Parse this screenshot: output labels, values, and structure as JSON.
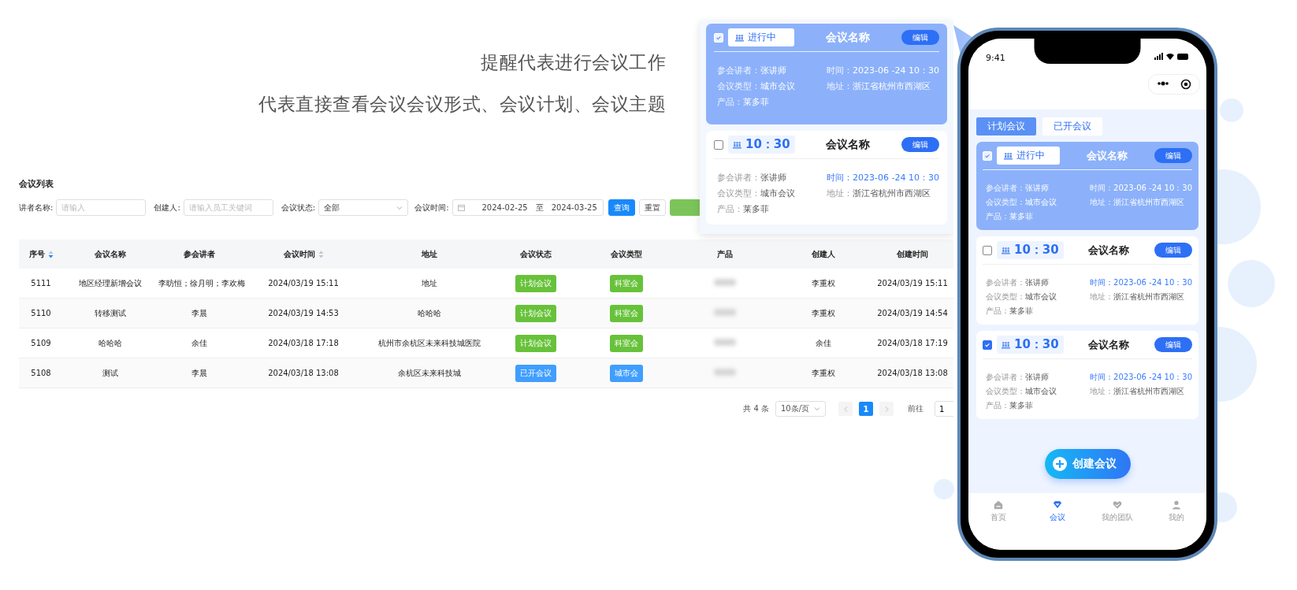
{
  "headline": [
    "提醒代表进行会议工作",
    "代表直接查看会议会议形式、会议计划、会议主题"
  ],
  "list": {
    "title": "会议列表",
    "filters": [
      {
        "kind": "input",
        "label": "讲者名称:",
        "placeholder": "请输入"
      },
      {
        "kind": "input",
        "label": "创建人:",
        "placeholder": "请输入员工关键词"
      },
      {
        "kind": "select",
        "label": "会议状态:",
        "value": "全部"
      },
      {
        "kind": "daterange",
        "label": "会议时间:",
        "start": "2024-02-25",
        "separator": "至",
        "end": "2024-03-25"
      }
    ],
    "buttons": [
      {
        "kind": "primary",
        "label": "查询"
      },
      {
        "kind": "default",
        "label": "重置"
      },
      {
        "kind": "success"
      }
    ],
    "columns": [
      {
        "label": "序号",
        "sortable": true,
        "sorted": true
      },
      {
        "label": "会议名称",
        "sortable": false
      },
      {
        "label": "参会讲者",
        "sortable": false
      },
      {
        "label": "会议时间",
        "sortable": true,
        "sorted": false
      },
      {
        "label": "地址",
        "sortable": false
      },
      {
        "label": "会议状态",
        "sortable": false
      },
      {
        "label": "会议类型",
        "sortable": false
      },
      {
        "label": "产品",
        "sortable": false
      },
      {
        "label": "创建人",
        "sortable": false
      },
      {
        "label": "创建时间",
        "sortable": false
      }
    ],
    "rows": [
      {
        "id": "5111",
        "name": "地区经理新增会议",
        "speakers": "李昉恒；徐月明；李欢梅",
        "time": "2024/03/19 15:11",
        "address": "地址",
        "status": {
          "label": "计划会议",
          "color": "#67c23a"
        },
        "type": {
          "label": "科室会",
          "color": "#67c23a"
        },
        "creator": "李重权",
        "created": "2024/03/19 15:11"
      },
      {
        "id": "5110",
        "name": "转移测试",
        "speakers": "李晨",
        "time": "2024/03/19 14:53",
        "address": "哈哈哈",
        "status": {
          "label": "计划会议",
          "color": "#67c23a"
        },
        "type": {
          "label": "科室会",
          "color": "#67c23a"
        },
        "creator": "李重权",
        "created": "2024/03/19 14:54"
      },
      {
        "id": "5109",
        "name": "哈哈哈",
        "speakers": "余佳",
        "time": "2024/03/18 17:18",
        "address": "杭州市余杭区未来科技城医院",
        "status": {
          "label": "计划会议",
          "color": "#67c23a"
        },
        "type": {
          "label": "科室会",
          "color": "#67c23a"
        },
        "creator": "余佳",
        "created": "2024/03/18 17:19"
      },
      {
        "id": "5108",
        "name": "测试",
        "speakers": "李晨",
        "time": "2024/03/18 13:08",
        "address": "余杭区未来科技城",
        "status": {
          "label": "已开会议",
          "color": "#409eff"
        },
        "type": {
          "label": "城市会",
          "color": "#409eff"
        },
        "creator": "李重权",
        "created": "2024/03/18 13:08"
      }
    ],
    "pagination": {
      "total": "共 4 条",
      "page_size": "10条/页",
      "pages": [
        {
          "label": "1",
          "selected": true
        }
      ],
      "goto_label": "前往",
      "goto_value": "1"
    }
  },
  "popup": {
    "cards": [
      {
        "selected": true,
        "checked": true,
        "badge": {
          "kind": "status",
          "text": "进行中"
        },
        "title": "会议名称",
        "edit": "编辑",
        "fields": [
          {
            "label": "参会讲者：",
            "value": "张讲师"
          },
          {
            "label": "时间：",
            "value": "2023-06 -24 10：30"
          },
          {
            "label": "会议类型：",
            "value": "城市会议"
          },
          {
            "label": "地址：",
            "value": "浙江省杭州市西湖区"
          },
          {
            "label": "产品：",
            "value": "莱多菲"
          }
        ]
      },
      {
        "selected": false,
        "checked": false,
        "badge": {
          "kind": "time",
          "text": "10：30"
        },
        "title": "会议名称",
        "edit": "编辑",
        "fields": [
          {
            "label": "参会讲者：",
            "value": "张讲师",
            "accent": false
          },
          {
            "label": "时间：",
            "value": "2023-06 -24 10：30",
            "accent": true
          },
          {
            "label": "会议类型：",
            "value": "城市会议",
            "accent": false
          },
          {
            "label": "地址：",
            "value": "浙江省杭州市西湖区",
            "accent": false
          },
          {
            "label": "产品：",
            "value": "莱多菲",
            "accent": false
          }
        ]
      }
    ]
  },
  "phone": {
    "status_time": "9:41",
    "tabs": [
      {
        "label": "计划会议",
        "selected": true
      },
      {
        "label": "已开会议",
        "selected": false
      }
    ],
    "cards": [
      {
        "selected": true,
        "checked": true,
        "badge": {
          "kind": "status",
          "text": "进行中"
        },
        "title": "会议名称",
        "edit": "编辑",
        "fields": [
          {
            "label": "参会讲者：",
            "value": "张讲师"
          },
          {
            "label": "时间：",
            "value": "2023-06 -24 10：30"
          },
          {
            "label": "会议类型：",
            "value": "城市会议"
          },
          {
            "label": "地址：",
            "value": "浙江省杭州市西湖区"
          },
          {
            "label": "产品：",
            "value": "莱多菲"
          }
        ]
      },
      {
        "selected": false,
        "checked": false,
        "badge": {
          "kind": "time",
          "text": "10：30"
        },
        "title": "会议名称",
        "edit": "编辑",
        "fields": [
          {
            "label": "参会讲者：",
            "value": "张讲师",
            "accent": false
          },
          {
            "label": "时间：",
            "value": "2023-06 -24 10：30",
            "accent": true
          },
          {
            "label": "会议类型：",
            "value": "城市会议",
            "accent": false
          },
          {
            "label": "地址：",
            "value": "浙江省杭州市西湖区",
            "accent": false
          },
          {
            "label": "产品：",
            "value": "莱多菲",
            "accent": false
          }
        ]
      },
      {
        "selected": false,
        "checked": true,
        "badge": {
          "kind": "time",
          "text": "10：30"
        },
        "title": "会议名称",
        "edit": "编辑",
        "fields": [
          {
            "label": "参会讲者：",
            "value": "张讲师",
            "accent": false
          },
          {
            "label": "时间：",
            "value": "2023-06 -24 10：30",
            "accent": true
          },
          {
            "label": "会议类型：",
            "value": "城市会议",
            "accent": false
          },
          {
            "label": "地址：",
            "value": "浙江省杭州市西湖区",
            "accent": false
          },
          {
            "label": "产品：",
            "value": "莱多菲",
            "accent": false
          }
        ]
      }
    ],
    "create_button": "创建会议",
    "nav": [
      {
        "kind": "home",
        "label": "首页",
        "selected": false
      },
      {
        "kind": "meeting",
        "label": "会议",
        "selected": true
      },
      {
        "kind": "team",
        "label": "我的团队",
        "selected": false
      },
      {
        "kind": "me",
        "label": "我的",
        "selected": false
      }
    ]
  }
}
